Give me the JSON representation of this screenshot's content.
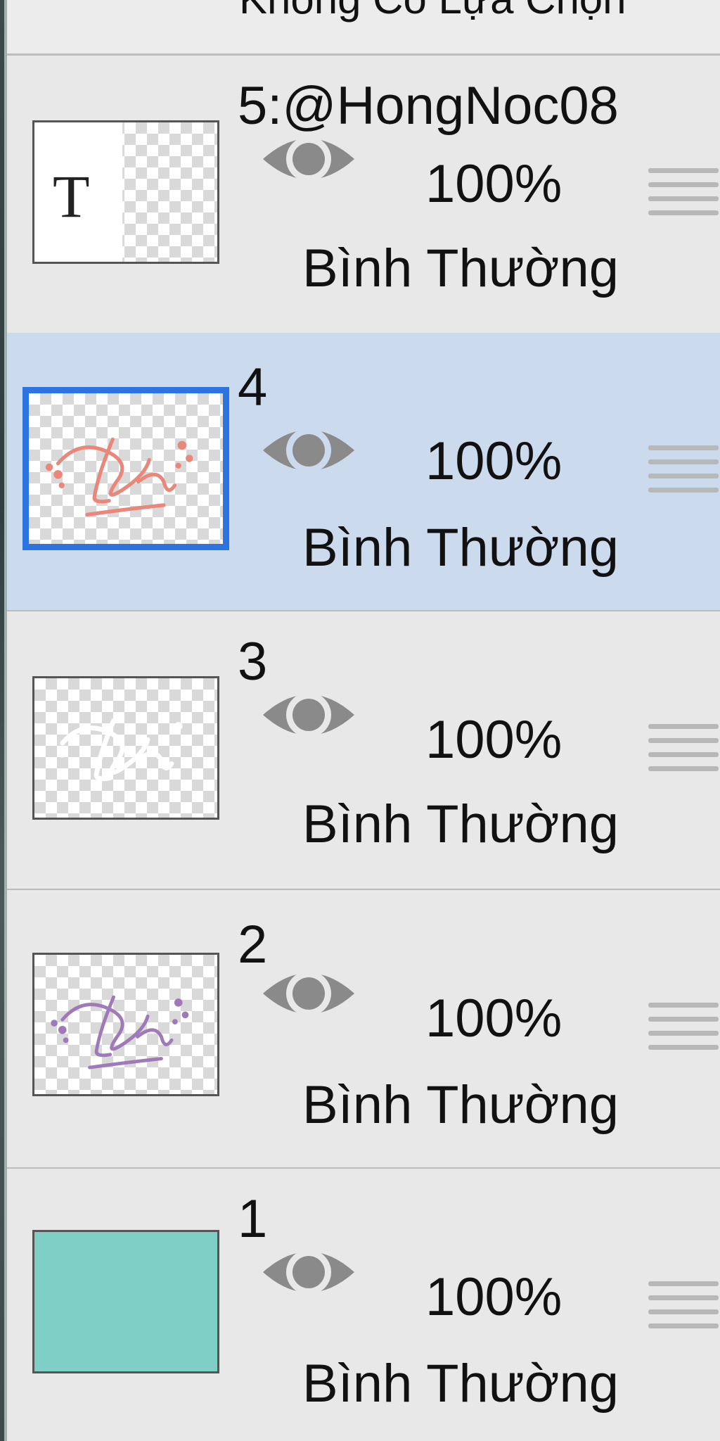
{
  "header": {
    "selection_text": "Không Có Lựa Chọn"
  },
  "layers": [
    {
      "name": "5:@HongNoc08",
      "opacity": "100%",
      "blend": "Bình Thường",
      "thumb": "text-layer",
      "thumb_glyph": "T"
    },
    {
      "name": "4",
      "opacity": "100%",
      "blend": "Bình Thường",
      "thumb": "pink-lettering",
      "selected": true
    },
    {
      "name": "3",
      "opacity": "100%",
      "blend": "Bình Thường",
      "thumb": "white-lettering"
    },
    {
      "name": "2",
      "opacity": "100%",
      "blend": "Bình Thường",
      "thumb": "purple-lettering"
    },
    {
      "name": "1",
      "opacity": "100%",
      "blend": "Bình Thường",
      "thumb": "solid-fill",
      "fill_color": "#7fcfc7"
    }
  ],
  "icons": {
    "visibility": "eye-icon",
    "reorder": "drag-handle-icon"
  },
  "colors": {
    "selected_row": "#ccdaee",
    "selected_border": "#2b74e2",
    "pink": "#e8877a",
    "purple": "#a07ab8",
    "teal": "#7fcfc7"
  }
}
